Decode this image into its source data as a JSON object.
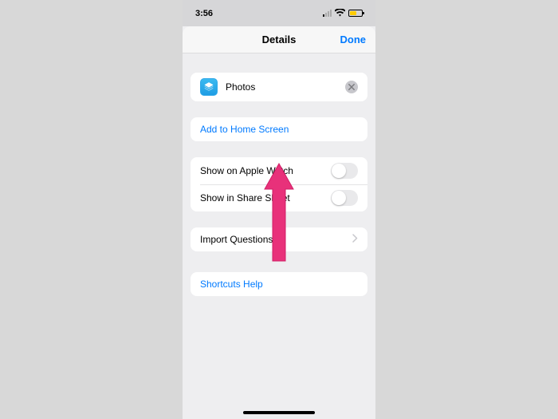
{
  "statusbar": {
    "time": "3:56"
  },
  "nav": {
    "title": "Details",
    "done": "Done"
  },
  "shortcut": {
    "name": "Photos"
  },
  "actions": {
    "addToHome": "Add to Home Screen"
  },
  "toggles": {
    "watch": "Show on Apple Watch",
    "share": "Show in Share Sheet"
  },
  "importRow": {
    "label": "Import Questions"
  },
  "help": {
    "label": "Shortcuts Help"
  }
}
